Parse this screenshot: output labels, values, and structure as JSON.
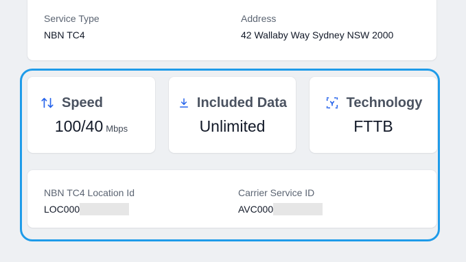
{
  "service": {
    "service_type_label": "Service Type",
    "service_type_value": "NBN TC4",
    "address_label": "Address",
    "address_value": "42 Wallaby Way Sydney NSW 2000"
  },
  "stats": {
    "speed": {
      "title": "Speed",
      "value": "100/40",
      "unit": "Mbps",
      "icon": "up-down-arrows-icon"
    },
    "data": {
      "title": "Included Data",
      "value": "Unlimited",
      "icon": "download-icon"
    },
    "technology": {
      "title": "Technology",
      "value": "FTTB",
      "icon": "technology-icon"
    }
  },
  "ids": {
    "location_label": "NBN TC4 Location Id",
    "location_value": "LOC000",
    "carrier_label": "Carrier Service ID",
    "carrier_value": "AVC000"
  },
  "colors": {
    "highlight_border": "#1e9be9",
    "icon_blue": "#2563eb",
    "background": "#eef0f3"
  }
}
